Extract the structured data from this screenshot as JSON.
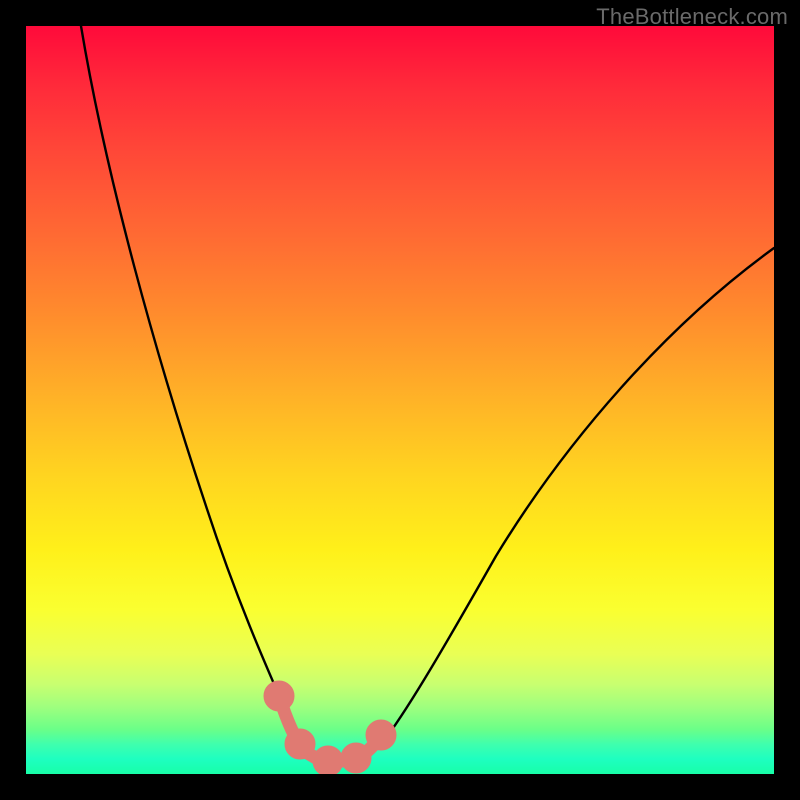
{
  "watermark": "TheBottleneck.com",
  "chart_data": {
    "type": "line",
    "title": "",
    "xlabel": "",
    "ylabel": "",
    "ylim": [
      0,
      100
    ],
    "x": [
      0.0,
      0.05,
      0.1,
      0.15,
      0.2,
      0.25,
      0.3,
      0.33,
      0.36,
      0.38,
      0.4,
      0.42,
      0.45,
      0.5,
      0.55,
      0.6,
      0.7,
      0.8,
      0.9,
      1.0
    ],
    "series": [
      {
        "name": "bottleneck-curve",
        "values": [
          100,
          82,
          66,
          51,
          38,
          26,
          16,
          10,
          5.5,
          3,
          1.5,
          1.2,
          1.2,
          3,
          7,
          13,
          28,
          44,
          58,
          70
        ]
      }
    ],
    "highlight_segment": {
      "name": "low-bottleneck-zone",
      "x": [
        0.33,
        0.355,
        0.37,
        0.385,
        0.4,
        0.42,
        0.44,
        0.455
      ],
      "values": [
        10.0,
        7.0,
        4.5,
        2.8,
        1.6,
        1.3,
        1.5,
        2.6
      ]
    },
    "gradient_colors": {
      "top": "#ff0a3a",
      "mid_upper": "#ffb327",
      "mid_lower": "#fff01a",
      "bottom": "#18ffa8"
    }
  }
}
